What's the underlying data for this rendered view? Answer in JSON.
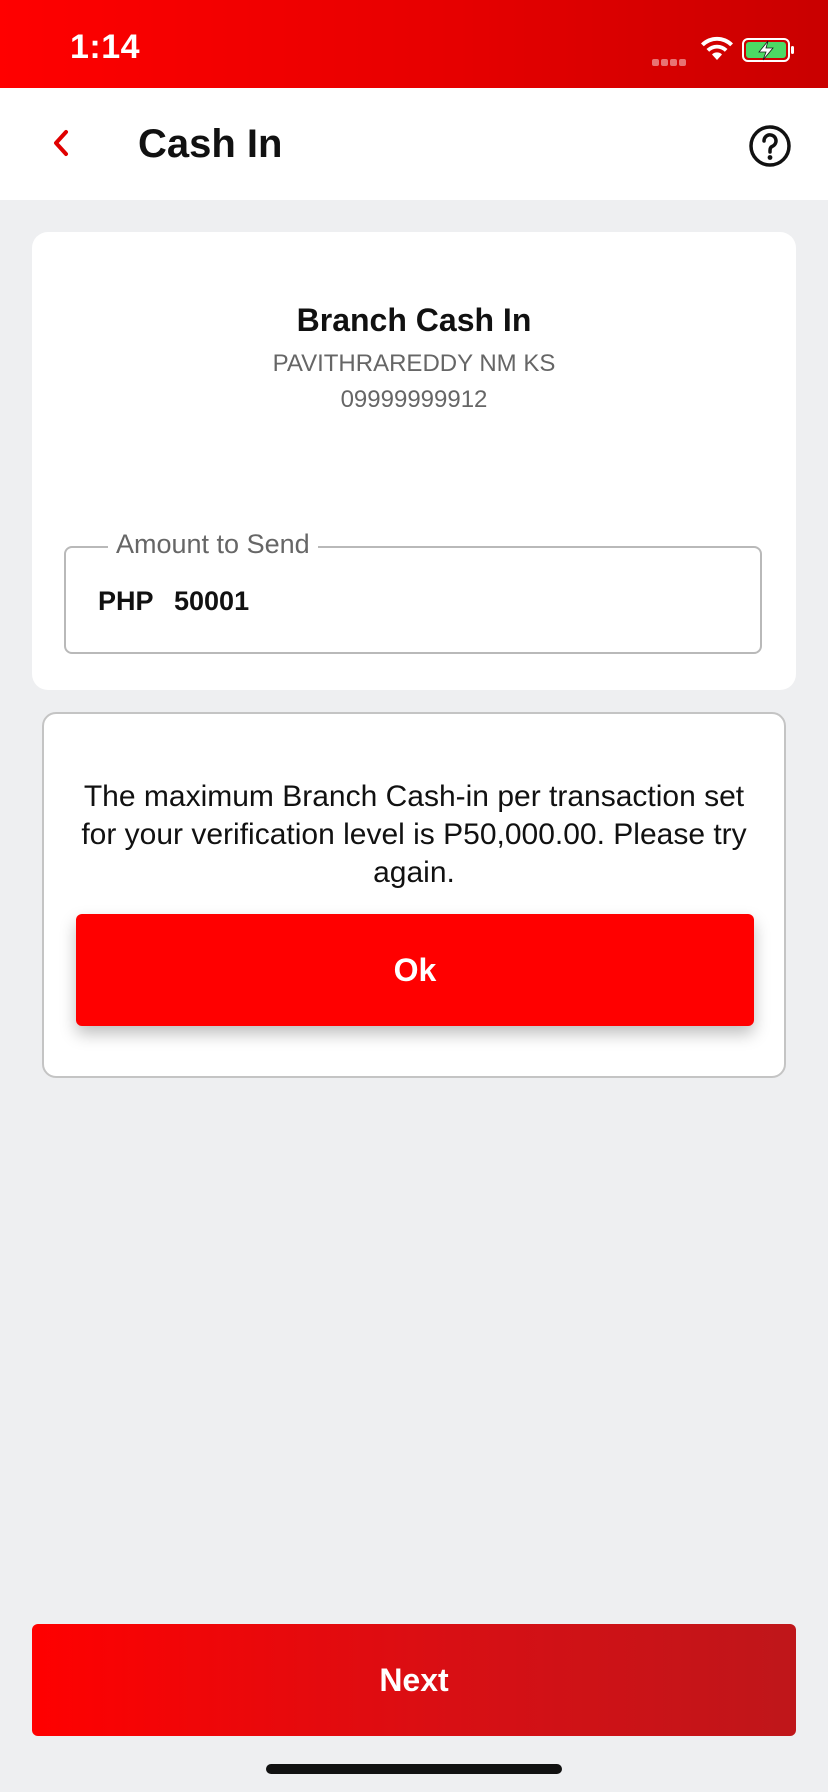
{
  "status_bar": {
    "time": "1:14",
    "icons": [
      "signal-icon",
      "wifi-icon",
      "battery-charging-icon"
    ]
  },
  "header": {
    "back_icon": "chevron-left-icon",
    "title": "Cash In",
    "help_icon": "question-circle-icon"
  },
  "card": {
    "title": "Branch Cash In",
    "account_name": "PAVITHRAREDDY NM KS",
    "account_number": "09999999912",
    "amount_field": {
      "label": "Amount to Send",
      "currency": "PHP",
      "value": "50001"
    }
  },
  "alert": {
    "message": "The maximum Branch Cash-in per transaction set for your verification level is P50,000.00. Please try again.",
    "ok_label": "Ok"
  },
  "footer": {
    "next_label": "Next"
  },
  "colors": {
    "brand_red": "#ff0000",
    "brand_dark_red": "#bf161a",
    "background": "#eeeff1",
    "card": "#ffffff",
    "battery_green": "#4cd964"
  }
}
